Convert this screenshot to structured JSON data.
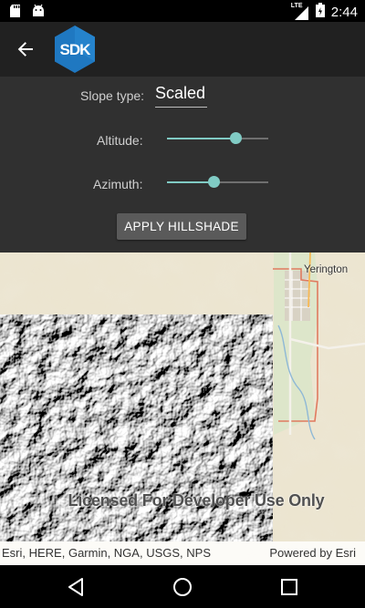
{
  "status_bar": {
    "network_label": "LTE",
    "time": "2:44",
    "icons": [
      "sd-card-icon",
      "android-icon",
      "signal-icon",
      "battery-icon"
    ]
  },
  "app_bar": {
    "logo_text": "SDK",
    "icons": [
      "back-arrow-icon",
      "sdk-logo-icon"
    ]
  },
  "controls": {
    "slope_type_label": "Slope type:",
    "slope_type_value": "Scaled",
    "altitude_label": "Altitude:",
    "altitude_level": 0.68,
    "azimuth_label": "Azimuth:",
    "azimuth_level": 0.46,
    "apply_button": "APPLY HILLSHADE",
    "accent_color": "#80cbc4"
  },
  "map": {
    "place_label": "Yerington",
    "watermark": "Licensed For Developer Use Only",
    "attribution": "Esri, HERE, Garmin, NGA, USGS, NPS",
    "powered_by": "Powered by Esri"
  },
  "nav_bar": {
    "icons": [
      "back-triangle-icon",
      "home-circle-icon",
      "recents-square-icon"
    ]
  }
}
